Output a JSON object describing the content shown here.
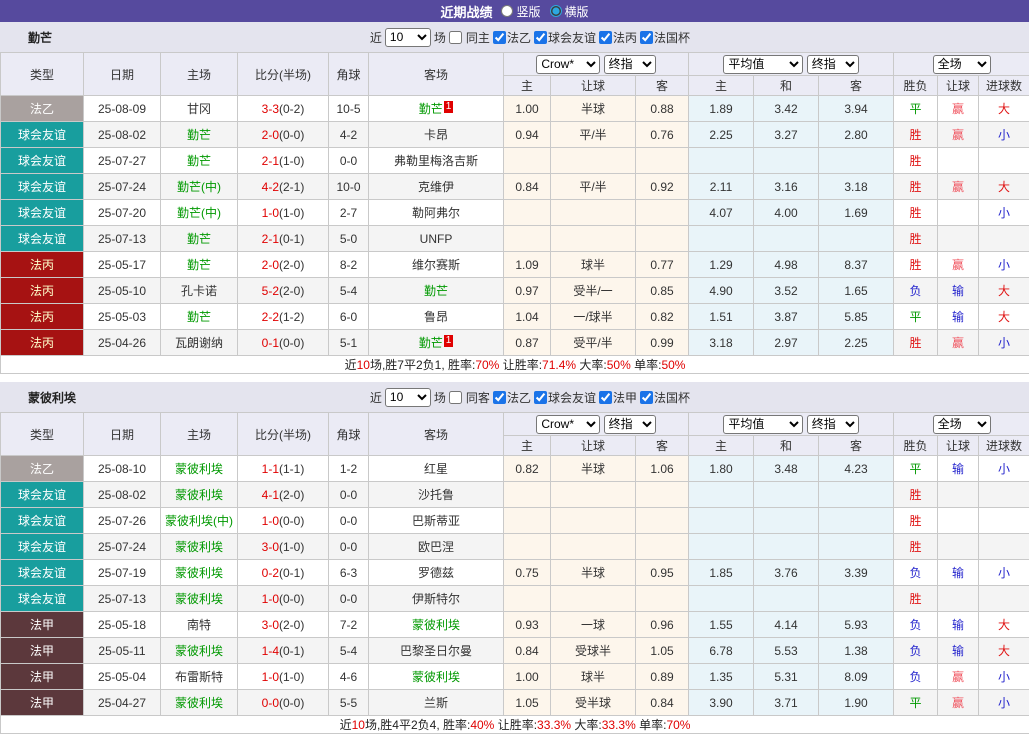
{
  "title_bar": {
    "title": "近期战绩",
    "layout_options": [
      {
        "label": "竖版",
        "checked": false
      },
      {
        "label": "横版",
        "checked": true
      }
    ]
  },
  "columns": {
    "left": [
      "类型",
      "日期",
      "主场",
      "比分(半场)",
      "角球",
      "客场"
    ],
    "asian_sub": [
      "主",
      "让球",
      "客"
    ],
    "euro_sub": [
      "主",
      "和",
      "客"
    ],
    "result_sub": [
      "胜负",
      "让球",
      "进球数"
    ]
  },
  "colors": {
    "title_bar_bg": "#564a9e",
    "section_head_bg": "#e4e4ee",
    "table_header_bg": "#ebebf5",
    "asian_col_bg": "#fdf6ec",
    "euro_col_bg": "#e9f4f9",
    "league_badges": {
      "法乙": "#a9a19f",
      "球会友谊": "#189e9e",
      "法丙": "#a61212",
      "法甲": "#5c383c"
    },
    "team_highlight_green": "#009900",
    "score_red": "#e00000",
    "win_red": "#e01414",
    "draw_green": "#009900",
    "lose_blue": "#2525cd",
    "handicap_win_pink": "#f0545f",
    "summary_highlight_red": "#e00000",
    "checkbox_blue": "#1a73e8",
    "radio_cyan": "#2ea8e0"
  },
  "sections": [
    {
      "team": "勤芒",
      "controls": {
        "near_label": "近",
        "count": "10",
        "matches_label": "场",
        "same_label": "同主",
        "same_checked": false,
        "leagues": [
          {
            "label": "法乙",
            "checked": true
          },
          {
            "label": "球会友谊",
            "checked": true
          },
          {
            "label": "法丙",
            "checked": true
          },
          {
            "label": "法国杯",
            "checked": true
          }
        ]
      },
      "odds_selects": {
        "asian_source": "Crow*",
        "asian_index": "终指",
        "euro_source": "平均值",
        "euro_index": "终指",
        "scope": "全场"
      },
      "rows": [
        {
          "league": "法乙",
          "date": "25-08-09",
          "home": {
            "text": "甘冈",
            "green": false
          },
          "score_full": "3-3",
          "score_half": "(0-2)",
          "corner": "10-5",
          "away": {
            "text": "勤芒",
            "green": true,
            "badge": "1"
          },
          "asian": {
            "home": "1.00",
            "line": "半球",
            "away": "0.88"
          },
          "europe": {
            "home": "1.89",
            "draw": "3.42",
            "away": "3.94"
          },
          "outcome": "平",
          "handicap": "赢",
          "goals": "大"
        },
        {
          "league": "球会友谊",
          "date": "25-08-02",
          "home": {
            "text": "勤芒",
            "green": true
          },
          "score_full": "2-0",
          "score_half": "(0-0)",
          "corner": "4-2",
          "away": {
            "text": "卡昂",
            "green": false
          },
          "asian": {
            "home": "0.94",
            "line": "平/半",
            "away": "0.76"
          },
          "europe": {
            "home": "2.25",
            "draw": "3.27",
            "away": "2.80"
          },
          "outcome": "胜",
          "handicap": "赢",
          "goals": "小"
        },
        {
          "league": "球会友谊",
          "date": "25-07-27",
          "home": {
            "text": "勤芒",
            "green": true
          },
          "score_full": "2-1",
          "score_half": "(1-0)",
          "corner": "0-0",
          "away": {
            "text": "弗勒里梅洛吉斯",
            "green": false
          },
          "asian": {
            "home": "",
            "line": "",
            "away": ""
          },
          "europe": {
            "home": "",
            "draw": "",
            "away": ""
          },
          "outcome": "胜",
          "handicap": "",
          "goals": ""
        },
        {
          "league": "球会友谊",
          "date": "25-07-24",
          "home": {
            "text": "勤芒(中)",
            "green": true
          },
          "score_full": "4-2",
          "score_half": "(2-1)",
          "corner": "10-0",
          "away": {
            "text": "克维伊",
            "green": false
          },
          "asian": {
            "home": "0.84",
            "line": "平/半",
            "away": "0.92"
          },
          "europe": {
            "home": "2.11",
            "draw": "3.16",
            "away": "3.18"
          },
          "outcome": "胜",
          "handicap": "赢",
          "goals": "大"
        },
        {
          "league": "球会友谊",
          "date": "25-07-20",
          "home": {
            "text": "勤芒(中)",
            "green": true
          },
          "score_full": "1-0",
          "score_half": "(1-0)",
          "corner": "2-7",
          "away": {
            "text": "勒阿弗尔",
            "green": false
          },
          "asian": {
            "home": "",
            "line": "",
            "away": ""
          },
          "europe": {
            "home": "4.07",
            "draw": "4.00",
            "away": "1.69"
          },
          "outcome": "胜",
          "handicap": "",
          "goals": "小"
        },
        {
          "league": "球会友谊",
          "date": "25-07-13",
          "home": {
            "text": "勤芒",
            "green": true
          },
          "score_full": "2-1",
          "score_half": "(0-1)",
          "corner": "5-0",
          "away": {
            "text": "UNFP",
            "green": false
          },
          "asian": {
            "home": "",
            "line": "",
            "away": ""
          },
          "europe": {
            "home": "",
            "draw": "",
            "away": ""
          },
          "outcome": "胜",
          "handicap": "",
          "goals": ""
        },
        {
          "league": "法丙",
          "date": "25-05-17",
          "home": {
            "text": "勤芒",
            "green": true
          },
          "score_full": "2-0",
          "score_half": "(2-0)",
          "corner": "8-2",
          "away": {
            "text": "维尔赛斯",
            "green": false
          },
          "asian": {
            "home": "1.09",
            "line": "球半",
            "away": "0.77"
          },
          "europe": {
            "home": "1.29",
            "draw": "4.98",
            "away": "8.37"
          },
          "outcome": "胜",
          "handicap": "赢",
          "goals": "小"
        },
        {
          "league": "法丙",
          "date": "25-05-10",
          "home": {
            "text": "孔卡诺",
            "green": false
          },
          "score_full": "5-2",
          "score_half": "(2-0)",
          "corner": "5-4",
          "away": {
            "text": "勤芒",
            "green": true
          },
          "asian": {
            "home": "0.97",
            "line": "受半/一",
            "away": "0.85"
          },
          "europe": {
            "home": "4.90",
            "draw": "3.52",
            "away": "1.65"
          },
          "outcome": "负",
          "handicap": "输",
          "goals": "大"
        },
        {
          "league": "法丙",
          "date": "25-05-03",
          "home": {
            "text": "勤芒",
            "green": true
          },
          "score_full": "2-2",
          "score_half": "(1-2)",
          "corner": "6-0",
          "away": {
            "text": "鲁昂",
            "green": false
          },
          "asian": {
            "home": "1.04",
            "line": "一/球半",
            "away": "0.82"
          },
          "europe": {
            "home": "1.51",
            "draw": "3.87",
            "away": "5.85"
          },
          "outcome": "平",
          "handicap": "输",
          "goals": "大"
        },
        {
          "league": "法丙",
          "date": "25-04-26",
          "home": {
            "text": "瓦朗谢纳",
            "green": false
          },
          "score_full": "0-1",
          "score_half": "(0-0)",
          "corner": "5-1",
          "away": {
            "text": "勤芒",
            "green": true,
            "badge": "1"
          },
          "asian": {
            "home": "0.87",
            "line": "受平/半",
            "away": "0.99"
          },
          "europe": {
            "home": "3.18",
            "draw": "2.97",
            "away": "2.25"
          },
          "outcome": "胜",
          "handicap": "赢",
          "goals": "小"
        }
      ],
      "summary": [
        {
          "text": "近",
          "red": false
        },
        {
          "text": "10",
          "red": true
        },
        {
          "text": "场,胜7平2负1, 胜率:",
          "red": false
        },
        {
          "text": "70%",
          "red": true
        },
        {
          "text": " 让胜率:",
          "red": false
        },
        {
          "text": "71.4%",
          "red": true
        },
        {
          "text": " 大率:",
          "red": false
        },
        {
          "text": "50%",
          "red": true
        },
        {
          "text": " 单率:",
          "red": false
        },
        {
          "text": "50%",
          "red": true
        }
      ]
    },
    {
      "team": "蒙彼利埃",
      "controls": {
        "near_label": "近",
        "count": "10",
        "matches_label": "场",
        "same_label": "同客",
        "same_checked": false,
        "leagues": [
          {
            "label": "法乙",
            "checked": true
          },
          {
            "label": "球会友谊",
            "checked": true
          },
          {
            "label": "法甲",
            "checked": true
          },
          {
            "label": "法国杯",
            "checked": true
          }
        ]
      },
      "odds_selects": {
        "asian_source": "Crow*",
        "asian_index": "终指",
        "euro_source": "平均值",
        "euro_index": "终指",
        "scope": "全场"
      },
      "rows": [
        {
          "league": "法乙",
          "date": "25-08-10",
          "home": {
            "text": "蒙彼利埃",
            "green": true
          },
          "score_full": "1-1",
          "score_half": "(1-1)",
          "corner": "1-2",
          "away": {
            "text": "红星",
            "green": false
          },
          "asian": {
            "home": "0.82",
            "line": "半球",
            "away": "1.06"
          },
          "europe": {
            "home": "1.80",
            "draw": "3.48",
            "away": "4.23"
          },
          "outcome": "平",
          "handicap": "输",
          "goals": "小"
        },
        {
          "league": "球会友谊",
          "date": "25-08-02",
          "home": {
            "text": "蒙彼利埃",
            "green": true
          },
          "score_full": "4-1",
          "score_half": "(2-0)",
          "corner": "0-0",
          "away": {
            "text": "沙托鲁",
            "green": false
          },
          "asian": {
            "home": "",
            "line": "",
            "away": ""
          },
          "europe": {
            "home": "",
            "draw": "",
            "away": ""
          },
          "outcome": "胜",
          "handicap": "",
          "goals": ""
        },
        {
          "league": "球会友谊",
          "date": "25-07-26",
          "home": {
            "text": "蒙彼利埃(中)",
            "green": true
          },
          "score_full": "1-0",
          "score_half": "(0-0)",
          "corner": "0-0",
          "away": {
            "text": "巴斯蒂亚",
            "green": false
          },
          "asian": {
            "home": "",
            "line": "",
            "away": ""
          },
          "europe": {
            "home": "",
            "draw": "",
            "away": ""
          },
          "outcome": "胜",
          "handicap": "",
          "goals": ""
        },
        {
          "league": "球会友谊",
          "date": "25-07-24",
          "home": {
            "text": "蒙彼利埃",
            "green": true
          },
          "score_full": "3-0",
          "score_half": "(1-0)",
          "corner": "0-0",
          "away": {
            "text": "欧巴涅",
            "green": false
          },
          "asian": {
            "home": "",
            "line": "",
            "away": ""
          },
          "europe": {
            "home": "",
            "draw": "",
            "away": ""
          },
          "outcome": "胜",
          "handicap": "",
          "goals": ""
        },
        {
          "league": "球会友谊",
          "date": "25-07-19",
          "home": {
            "text": "蒙彼利埃",
            "green": true
          },
          "score_full": "0-2",
          "score_half": "(0-1)",
          "corner": "6-3",
          "away": {
            "text": "罗德兹",
            "green": false
          },
          "asian": {
            "home": "0.75",
            "line": "半球",
            "away": "0.95"
          },
          "europe": {
            "home": "1.85",
            "draw": "3.76",
            "away": "3.39"
          },
          "outcome": "负",
          "handicap": "输",
          "goals": "小"
        },
        {
          "league": "球会友谊",
          "date": "25-07-13",
          "home": {
            "text": "蒙彼利埃",
            "green": true
          },
          "score_full": "1-0",
          "score_half": "(0-0)",
          "corner": "0-0",
          "away": {
            "text": "伊斯特尔",
            "green": false
          },
          "asian": {
            "home": "",
            "line": "",
            "away": ""
          },
          "europe": {
            "home": "",
            "draw": "",
            "away": ""
          },
          "outcome": "胜",
          "handicap": "",
          "goals": ""
        },
        {
          "league": "法甲",
          "date": "25-05-18",
          "home": {
            "text": "南特",
            "green": false
          },
          "score_full": "3-0",
          "score_half": "(2-0)",
          "corner": "7-2",
          "away": {
            "text": "蒙彼利埃",
            "green": true
          },
          "asian": {
            "home": "0.93",
            "line": "一球",
            "away": "0.96"
          },
          "europe": {
            "home": "1.55",
            "draw": "4.14",
            "away": "5.93"
          },
          "outcome": "负",
          "handicap": "输",
          "goals": "大"
        },
        {
          "league": "法甲",
          "date": "25-05-11",
          "home": {
            "text": "蒙彼利埃",
            "green": true
          },
          "score_full": "1-4",
          "score_half": "(0-1)",
          "corner": "5-4",
          "away": {
            "text": "巴黎圣日尔曼",
            "green": false
          },
          "asian": {
            "home": "0.84",
            "line": "受球半",
            "away": "1.05"
          },
          "europe": {
            "home": "6.78",
            "draw": "5.53",
            "away": "1.38"
          },
          "outcome": "负",
          "handicap": "输",
          "goals": "大"
        },
        {
          "league": "法甲",
          "date": "25-05-04",
          "home": {
            "text": "布雷斯特",
            "green": false
          },
          "score_full": "1-0",
          "score_half": "(1-0)",
          "corner": "4-6",
          "away": {
            "text": "蒙彼利埃",
            "green": true
          },
          "asian": {
            "home": "1.00",
            "line": "球半",
            "away": "0.89"
          },
          "europe": {
            "home": "1.35",
            "draw": "5.31",
            "away": "8.09"
          },
          "outcome": "负",
          "handicap": "赢",
          "goals": "小"
        },
        {
          "league": "法甲",
          "date": "25-04-27",
          "home": {
            "text": "蒙彼利埃",
            "green": true
          },
          "score_full": "0-0",
          "score_half": "(0-0)",
          "corner": "5-5",
          "away": {
            "text": "兰斯",
            "green": false
          },
          "asian": {
            "home": "1.05",
            "line": "受半球",
            "away": "0.84"
          },
          "europe": {
            "home": "3.90",
            "draw": "3.71",
            "away": "1.90"
          },
          "outcome": "平",
          "handicap": "赢",
          "goals": "小"
        }
      ],
      "summary": [
        {
          "text": "近",
          "red": false
        },
        {
          "text": "10",
          "red": true
        },
        {
          "text": "场,胜4平2负4, 胜率:",
          "red": false
        },
        {
          "text": "40%",
          "red": true
        },
        {
          "text": " 让胜率:",
          "red": false
        },
        {
          "text": "33.3%",
          "red": true
        },
        {
          "text": " 大率:",
          "red": false
        },
        {
          "text": "33.3%",
          "red": true
        },
        {
          "text": " 单率:",
          "red": false
        },
        {
          "text": "70%",
          "red": true
        }
      ]
    }
  ]
}
